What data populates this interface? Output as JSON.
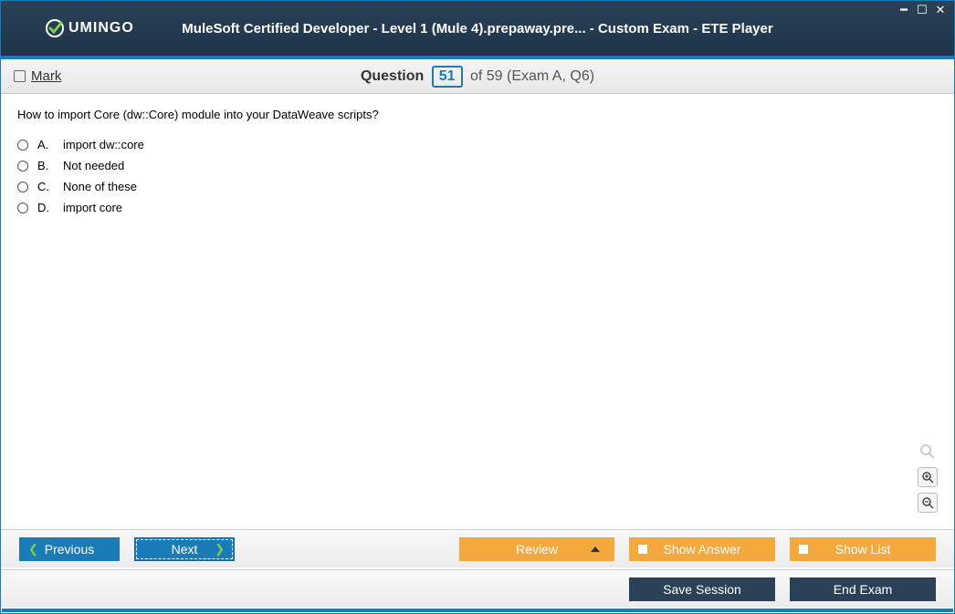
{
  "window": {
    "title": "MuleSoft Certified Developer - Level 1 (Mule 4).prepaway.pre... - Custom Exam - ETE Player",
    "logo_text": "UMINGO"
  },
  "infobar": {
    "mark_label": "Mark",
    "question_word": "Question",
    "current_num": "51",
    "total_text": "of 59 (Exam A, Q6)"
  },
  "question": {
    "text": "How to import Core (dw::Core) module into your DataWeave scripts?",
    "options": [
      {
        "letter": "A.",
        "text": "import dw::core"
      },
      {
        "letter": "B.",
        "text": "Not needed"
      },
      {
        "letter": "C.",
        "text": "None of these"
      },
      {
        "letter": "D.",
        "text": "import core"
      }
    ]
  },
  "buttons": {
    "previous": "Previous",
    "next": "Next",
    "review": "Review",
    "show_answer": "Show Answer",
    "show_list": "Show List",
    "save_session": "Save Session",
    "end_exam": "End Exam"
  }
}
